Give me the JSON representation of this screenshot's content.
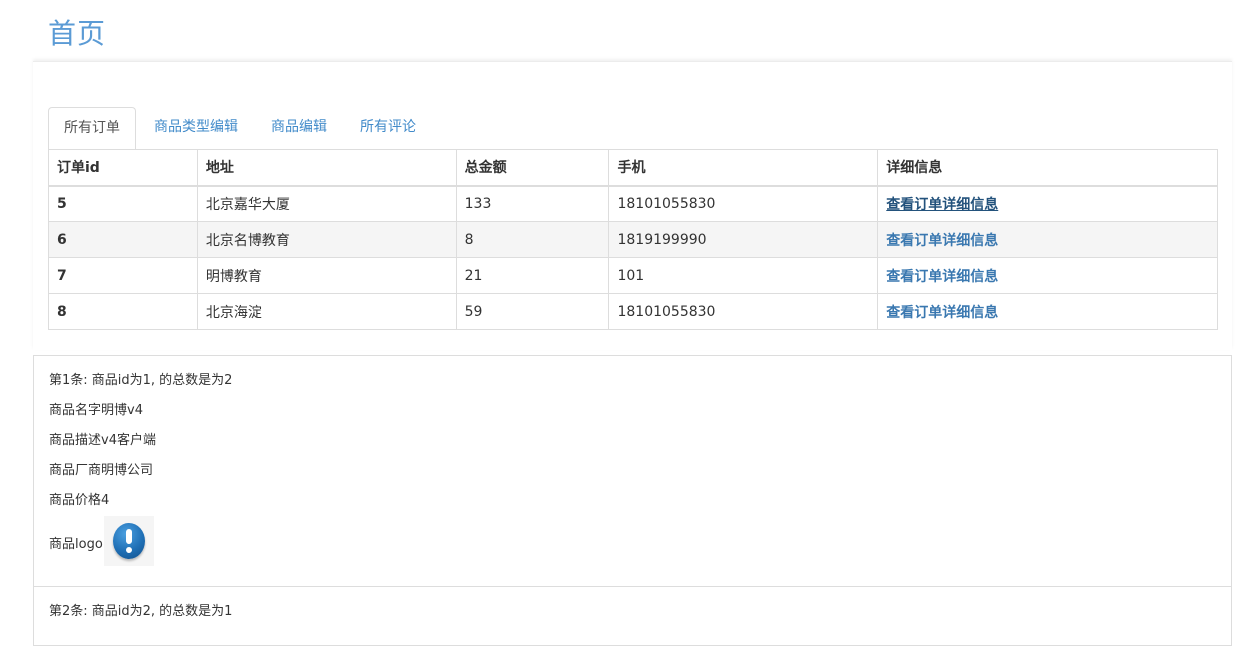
{
  "header": {
    "title": "首页"
  },
  "tabs": [
    {
      "label": "所有订单",
      "active": true
    },
    {
      "label": "商品类型编辑",
      "active": false
    },
    {
      "label": "商品编辑",
      "active": false
    },
    {
      "label": "所有评论",
      "active": false
    }
  ],
  "orders": {
    "columns": [
      "订单id",
      "地址",
      "总金额",
      "手机",
      "详细信息"
    ],
    "rows": [
      {
        "id": "5",
        "address": "北京嘉华大厦",
        "total": "133",
        "phone": "18101055830",
        "detail": "查看订单详细信息"
      },
      {
        "id": "6",
        "address": "北京名博教育",
        "total": "8",
        "phone": "1819199990",
        "detail": "查看订单详细信息"
      },
      {
        "id": "7",
        "address": "明博教育",
        "total": "21",
        "phone": "101",
        "detail": "查看订单详细信息"
      },
      {
        "id": "8",
        "address": "北京海淀",
        "total": "59",
        "phone": "18101055830",
        "detail": "查看订单详细信息"
      }
    ]
  },
  "goods": [
    {
      "summary": "第1条: 商品id为1, 的总数是为2",
      "name": "商品名字明博v4",
      "description": "商品描述v4客户端",
      "vendor": "商品厂商明博公司",
      "price": "商品价格4",
      "logo_label": "商品logo",
      "logo_icon": "exclamation-icon"
    },
    {
      "summary": "第2条: 商品id为2, 的总数是为1"
    }
  ],
  "colors": {
    "title": "#5b9bd5",
    "link": "#3a78b0",
    "border": "#dddddd",
    "stripe": "#f5f5f5"
  }
}
